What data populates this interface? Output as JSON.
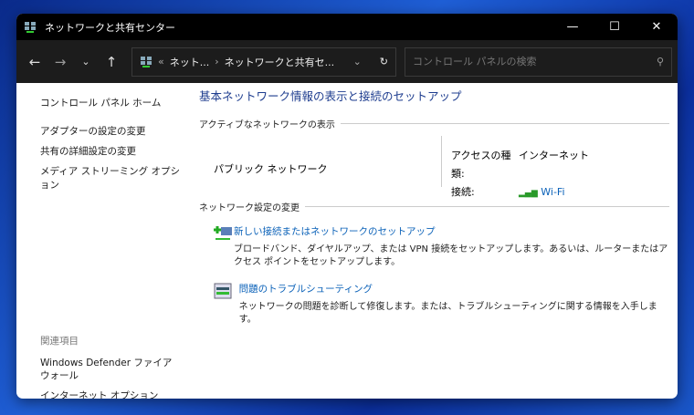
{
  "window": {
    "title": "ネットワークと共有センター"
  },
  "toolbar": {
    "breadcrumb_root": "ネット...",
    "breadcrumb_current": "ネットワークと共有セ...",
    "search_placeholder": "コントロール パネルの検索"
  },
  "sidebar": {
    "home": "コントロール パネル ホーム",
    "links": [
      "アダプターの設定の変更",
      "共有の詳細設定の変更",
      "メディア ストリーミング オプション"
    ],
    "related_heading": "関連項目",
    "related": [
      "Windows Defender ファイアウォール",
      "インターネット オプション"
    ]
  },
  "main": {
    "title": "基本ネットワーク情報の表示と接続のセットアップ",
    "active_heading": "アクティブなネットワークの表示",
    "network_name": "パブリック ネットワーク",
    "access_label": "アクセスの種類:",
    "access_value": "インターネット",
    "conn_label": "接続:",
    "conn_value": "Wi-Fi",
    "change_heading": "ネットワーク設定の変更",
    "tasks": [
      {
        "title": "新しい接続またはネットワークのセットアップ",
        "desc": "ブロードバンド、ダイヤルアップ、または VPN 接続をセットアップします。あるいは、ルーターまたはアクセス ポイントをセットアップします。"
      },
      {
        "title": "問題のトラブルシューティング",
        "desc": "ネットワークの問題を診断して修復します。または、トラブルシューティングに関する情報を入手します。"
      }
    ]
  }
}
